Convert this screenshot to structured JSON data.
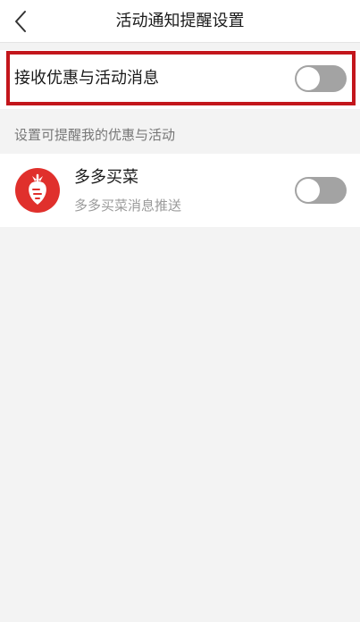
{
  "header": {
    "title": "活动通知提醒设置",
    "back_icon": "chevron-left-icon"
  },
  "main_setting": {
    "label": "接收优惠与活动消息",
    "enabled": false,
    "highlight_color": "#c3161c"
  },
  "section": {
    "label": "设置可提醒我的优惠与活动"
  },
  "apps": [
    {
      "name": "多多买菜",
      "subtitle": "多多买菜消息推送",
      "icon": "carrot-logo-icon",
      "icon_color": "#e0302c",
      "enabled": false
    }
  ],
  "colors": {
    "toggle_off": "#a3a3a3",
    "background": "#f3f3f3"
  }
}
